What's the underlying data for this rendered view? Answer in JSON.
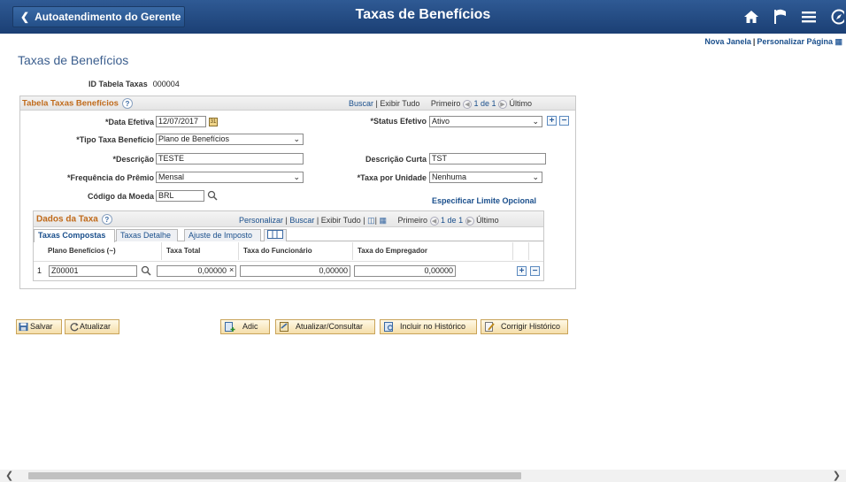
{
  "banner": {
    "back_label": "Autoatendimento do Gerente",
    "title": "Taxas de Benefícios",
    "icons": [
      "home-icon",
      "flag-icon",
      "menu-icon",
      "navigator-icon"
    ]
  },
  "toplinks": {
    "new_window": "Nova Janela",
    "separator": "|",
    "personalize": "Personalizar Página"
  },
  "page_title": "Taxas de Benefícios",
  "id_row": {
    "label": "ID Tabela Taxas",
    "value": "000004"
  },
  "main_box": {
    "title": "Tabela Taxas Benefícios",
    "find": "Buscar",
    "view_all": "Exibir Tudo",
    "first": "Primeiro",
    "range": "1 de 1",
    "last": "Último",
    "fields": {
      "effdt_label": "*Data Efetiva",
      "effdt_value": "12/07/2017",
      "status_label": "*Status Efetivo",
      "status_value": "Ativo",
      "type_label": "*Tipo Taxa Benefício",
      "type_value": "Plano de Benefícios",
      "descr_label": "*Descrição",
      "descr_value": "TESTE",
      "short_label": "Descrição Curta",
      "short_value": "TST",
      "freq_label": "*Frequência do Prêmio",
      "freq_value": "Mensal",
      "per_unit_label": "*Taxa por Unidade",
      "per_unit_value": "Nenhuma",
      "currency_label": "Código da Moeda",
      "currency_value": "BRL",
      "optional_limit_link": "Especificar Limite Opcional"
    }
  },
  "grid_box": {
    "title": "Dados da Taxa",
    "personalize": "Personalizar",
    "find": "Buscar",
    "view_all": "Exibir Tudo",
    "first": "Primeiro",
    "range": "1 de 1",
    "last": "Último",
    "tabs": [
      "Taxas Compostas",
      "Taxas Detalhe",
      "Ajuste de Imposto"
    ],
    "columns": [
      "Plano Benefícios (~)",
      "Taxa Total",
      "Taxa do Funcionário",
      "Taxa do Empregador"
    ],
    "rows": [
      {
        "num": "1",
        "plan": "Z00001",
        "total": "0,00000",
        "employee": "0,00000",
        "employer": "0,00000"
      }
    ]
  },
  "toolbar": {
    "save": "Salvar",
    "refresh": "Atualizar",
    "add": "Adic",
    "update_display": "Atualizar/Consultar",
    "include_history": "Incluir no Histórico",
    "correct_history": "Corrigir Histórico"
  },
  "colors": {
    "banner": "#244f88",
    "link": "#1a4f8c",
    "section_title": "#c06a1a",
    "page_title": "#3b5e8e"
  }
}
